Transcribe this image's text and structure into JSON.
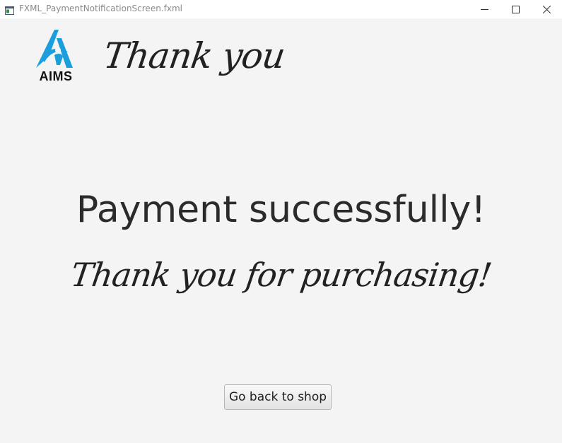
{
  "window": {
    "title": "FXML_PaymentNotificationScreen.fxml",
    "controls": [
      "minimize-icon",
      "maximize-icon",
      "close-icon"
    ]
  },
  "header": {
    "logo_text": "AIMS",
    "script_title": "Thank you"
  },
  "main": {
    "heading": "Payment successfully!",
    "subtitle": "Thank you for purchasing!"
  },
  "actions": {
    "back_button_label": "Go back to shop"
  },
  "colors": {
    "logo_blue": "#1a9fdc",
    "background": "#f4f4f4",
    "text": "#2b2b2b"
  }
}
